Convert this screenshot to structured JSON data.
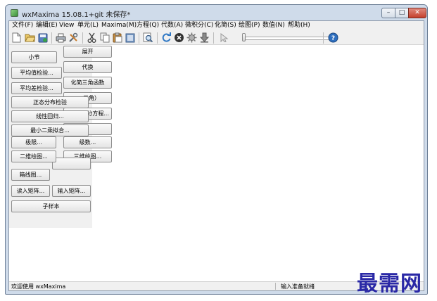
{
  "window": {
    "title": "wxMaxima 15.08.1+git 未保存*"
  },
  "menu": [
    "文件(F)",
    "编辑(E)",
    "View",
    "单元(L)",
    "Maxima(M)",
    "方程(Q)",
    "代数(A)",
    "微积分(C)",
    "化简(S)",
    "绘图(P)",
    "数值(N)",
    "帮助(H)"
  ],
  "palette": {
    "section": "小节",
    "expand": "展开",
    "mean_test": "平均值检验...",
    "substitute": "代换",
    "diff_test": "平均差检验...",
    "trigsimp": "化简三角函数",
    "trig_partial": "三角）",
    "normal_test": "正态分布检验",
    "eq_partial": "分方程...",
    "linreg": "线性回归...",
    "lsq": "最小二乘拟合...",
    "limit": "极限...",
    "series": "级数...",
    "plot2d": "二维绘图...",
    "plot3d": "三维绘图...",
    "boxplot": "箱线图...",
    "read_matrix": "读入矩阵...",
    "enter_matrix": "输入矩阵...",
    "subsample": "子样本"
  },
  "status": {
    "left": "欢迎使用 wxMaxima",
    "right": "输入准备就绪"
  },
  "watermark": "最需网",
  "icons": [
    "new-icon",
    "open-icon",
    "save-icon",
    "print-icon",
    "preferences-icon",
    "cut-icon",
    "copy-icon",
    "paste-icon",
    "select-all-icon",
    "find-icon",
    "restart-icon",
    "interrupt-icon",
    "settings-icon",
    "download-icon",
    "animation-icon",
    "help-icon"
  ]
}
